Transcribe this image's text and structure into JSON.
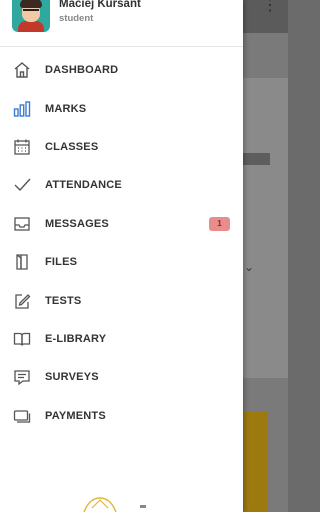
{
  "user": {
    "name": "Maciej Kursant",
    "role": "student"
  },
  "menu": [
    {
      "label": "DASHBOARD",
      "icon": "home-icon"
    },
    {
      "label": "MARKS",
      "icon": "bar-chart-icon"
    },
    {
      "label": "CLASSES",
      "icon": "calendar-icon"
    },
    {
      "label": "ATTENDANCE",
      "icon": "checkmark-icon"
    },
    {
      "label": "MESSAGES",
      "icon": "inbox-icon",
      "badge": "1"
    },
    {
      "label": "FILES",
      "icon": "file-icon"
    },
    {
      "label": "TESTS",
      "icon": "edit-icon"
    },
    {
      "label": "E-LIBRARY",
      "icon": "book-icon"
    },
    {
      "label": "SURVEYS",
      "icon": "survey-icon"
    },
    {
      "label": "PAYMENTS",
      "icon": "payment-icon"
    }
  ],
  "colors": {
    "accent": "#3a7bd5",
    "badge_bg": "#e88c8c",
    "badge_text": "#a02020"
  }
}
